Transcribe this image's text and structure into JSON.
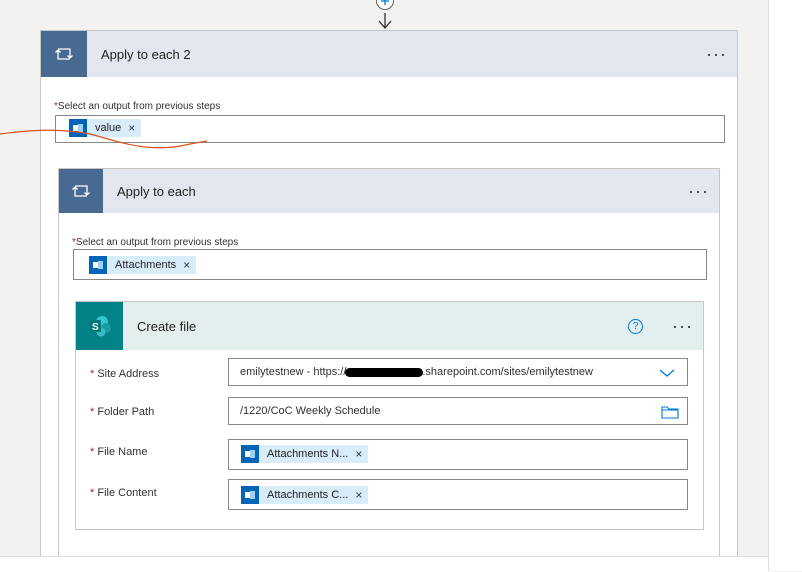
{
  "apply2": {
    "title": "Apply to each 2",
    "more": "···",
    "select_label": "Select an output from previous steps",
    "token": "value",
    "token_x": "×"
  },
  "apply1": {
    "title": "Apply to each",
    "more": "···",
    "select_label": "Select an output from previous steps",
    "token": "Attachments",
    "token_x": "×"
  },
  "create_file": {
    "title": "Create file",
    "help": "?",
    "more": "···",
    "fields": {
      "site_label": "Site Address",
      "site_value_a": "emilytestnew - https://",
      "site_value_b": ".sharepoint.com/sites/emilytestnew",
      "folder_label": "Folder Path",
      "folder_value": "/1220/CoC Weekly Schedule",
      "name_label": "File Name",
      "name_token": "Attachments N...",
      "content_label": "File Content",
      "content_token": "Attachments C..."
    }
  },
  "req_mark": "*",
  "colors": {
    "header_bg": "#e1e6ef",
    "loop_icon_bg": "#486991",
    "create_header_bg": "#e3eeee",
    "sharepoint": "#038387",
    "token_bg": "#d9ecfa",
    "outlook": "#0364b8",
    "annotation": "#d9541e"
  },
  "icons": [
    "add-step-icon",
    "arrow-down-icon",
    "loop-icon",
    "outlook-icon",
    "sharepoint-icon",
    "help-icon",
    "chevron-down-icon",
    "folder-icon"
  ]
}
